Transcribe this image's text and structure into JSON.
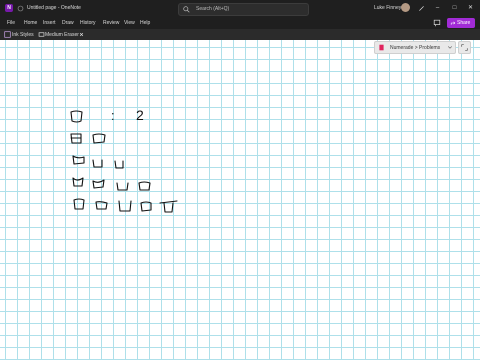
{
  "titlebar": {
    "app_initial": "N",
    "title": "Untitled page - OneNote",
    "search_placeholder": "Search (Alt+Q)",
    "user_name": "Luke Finney"
  },
  "menu": {
    "items": [
      "File",
      "Home",
      "Insert",
      "Draw",
      "History",
      "Review",
      "View",
      "Help"
    ],
    "share_label": "Share"
  },
  "inkbar": {
    "ink_styles": "Ink Styles",
    "eraser": "Medium Eraser"
  },
  "notebook": {
    "breadcrumb": "Numerade > Problems"
  },
  "ink": {
    "ratio_colon": ":",
    "ratio_value": "2"
  },
  "colors": {
    "chrome": "#1f1f1f",
    "accent": "#a12bd6",
    "grid": "#aee0ea"
  }
}
